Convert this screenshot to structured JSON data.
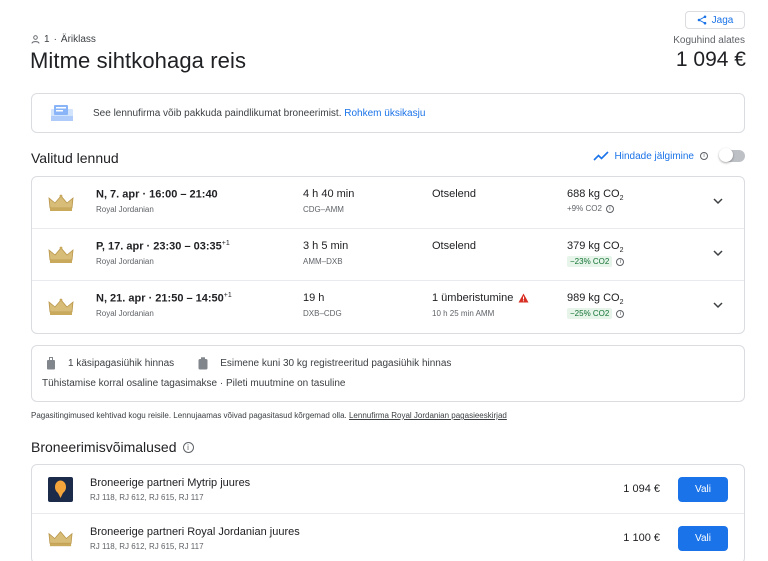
{
  "header": {
    "share_label": "Jaga",
    "passengers": "1",
    "cabin_class": "Äriklass",
    "title": "Mitme sihtkohaga reis",
    "total_label": "Koguhind alates",
    "total_price": "1 094 €"
  },
  "notice": {
    "text": "See lennufirma võib pakkuda paindlikumat broneerimist.",
    "link": "Rohkem üksikasju"
  },
  "selected": {
    "heading": "Valitud lennud",
    "track_label": "Hindade jälgimine",
    "flights": [
      {
        "date_time": "N, 7. apr  ·  16:00 – 21:40",
        "next_day": "",
        "airline": "Royal Jordanian",
        "duration": "4 h 40 min",
        "route": "CDG–AMM",
        "stops": "Otselend",
        "stops_detail": "",
        "co2": "688 kg CO",
        "co2_diff": "+9% CO2",
        "co2_good": false
      },
      {
        "date_time": "P, 17. apr  ·  23:30 – 03:35",
        "next_day": "+1",
        "airline": "Royal Jordanian",
        "duration": "3 h 5 min",
        "route": "AMM–DXB",
        "stops": "Otselend",
        "stops_detail": "",
        "co2": "379 kg CO",
        "co2_diff": "−23% CO2",
        "co2_good": true
      },
      {
        "date_time": "N, 21. apr  ·  21:50 – 14:50",
        "next_day": "+1",
        "airline": "Royal Jordanian",
        "duration": "19 h",
        "route": "DXB–CDG",
        "stops": "1 ümberistumine",
        "stops_detail": "10 h 25 min AMM",
        "co2": "989 kg CO",
        "co2_diff": "−25% CO2",
        "co2_good": true
      }
    ]
  },
  "baggage": {
    "carry_on": "1 käsipagasiühik hinnas",
    "checked": "Esimene kuni 30 kg registreeritud pagasiühik hinnas",
    "fare_rules": "Tühistamise korral osaline tagasimakse · Pileti muutmine on tasuline"
  },
  "fine_print": {
    "text": "Pagasitingimused kehtivad kogu reisile. Lennujaamas võivad pagasitasud kõrgemad olla.",
    "link": "Lennufirma Royal Jordanian pagasieeskirjad"
  },
  "booking": {
    "heading": "Broneerimisvõimalused",
    "options": [
      {
        "name": "Broneerige partneri Mytrip juures",
        "codes": "RJ 118, RJ 612, RJ 615, RJ 117",
        "price": "1 094 €",
        "button": "Vali"
      },
      {
        "name": "Broneerige partneri Royal Jordanian juures",
        "codes": "RJ 118, RJ 612, RJ 615, RJ 117",
        "price": "1 100 €",
        "button": "Vali"
      }
    ]
  },
  "colors": {
    "accent": "#1a73e8",
    "crown_gold": "#c9a95c",
    "warning": "#d93025",
    "green_badge": "#137333"
  }
}
